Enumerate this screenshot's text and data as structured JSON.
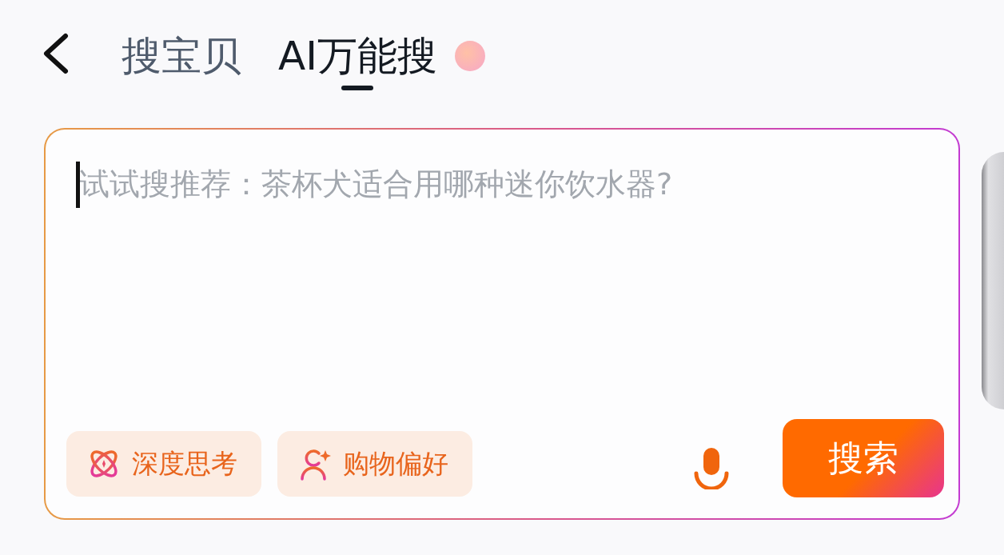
{
  "tabs": [
    {
      "label": "搜宝贝",
      "selected": false
    },
    {
      "label": "AI万能搜",
      "selected": true
    }
  ],
  "search": {
    "placeholder": "试试搜推荐：茶杯犬适合用哪种迷你饮水器?"
  },
  "options": [
    {
      "kind": "deep-think",
      "label": "深度思考"
    },
    {
      "kind": "preference",
      "label": "购物偏好"
    }
  ],
  "search_button": {
    "label": "搜索"
  }
}
